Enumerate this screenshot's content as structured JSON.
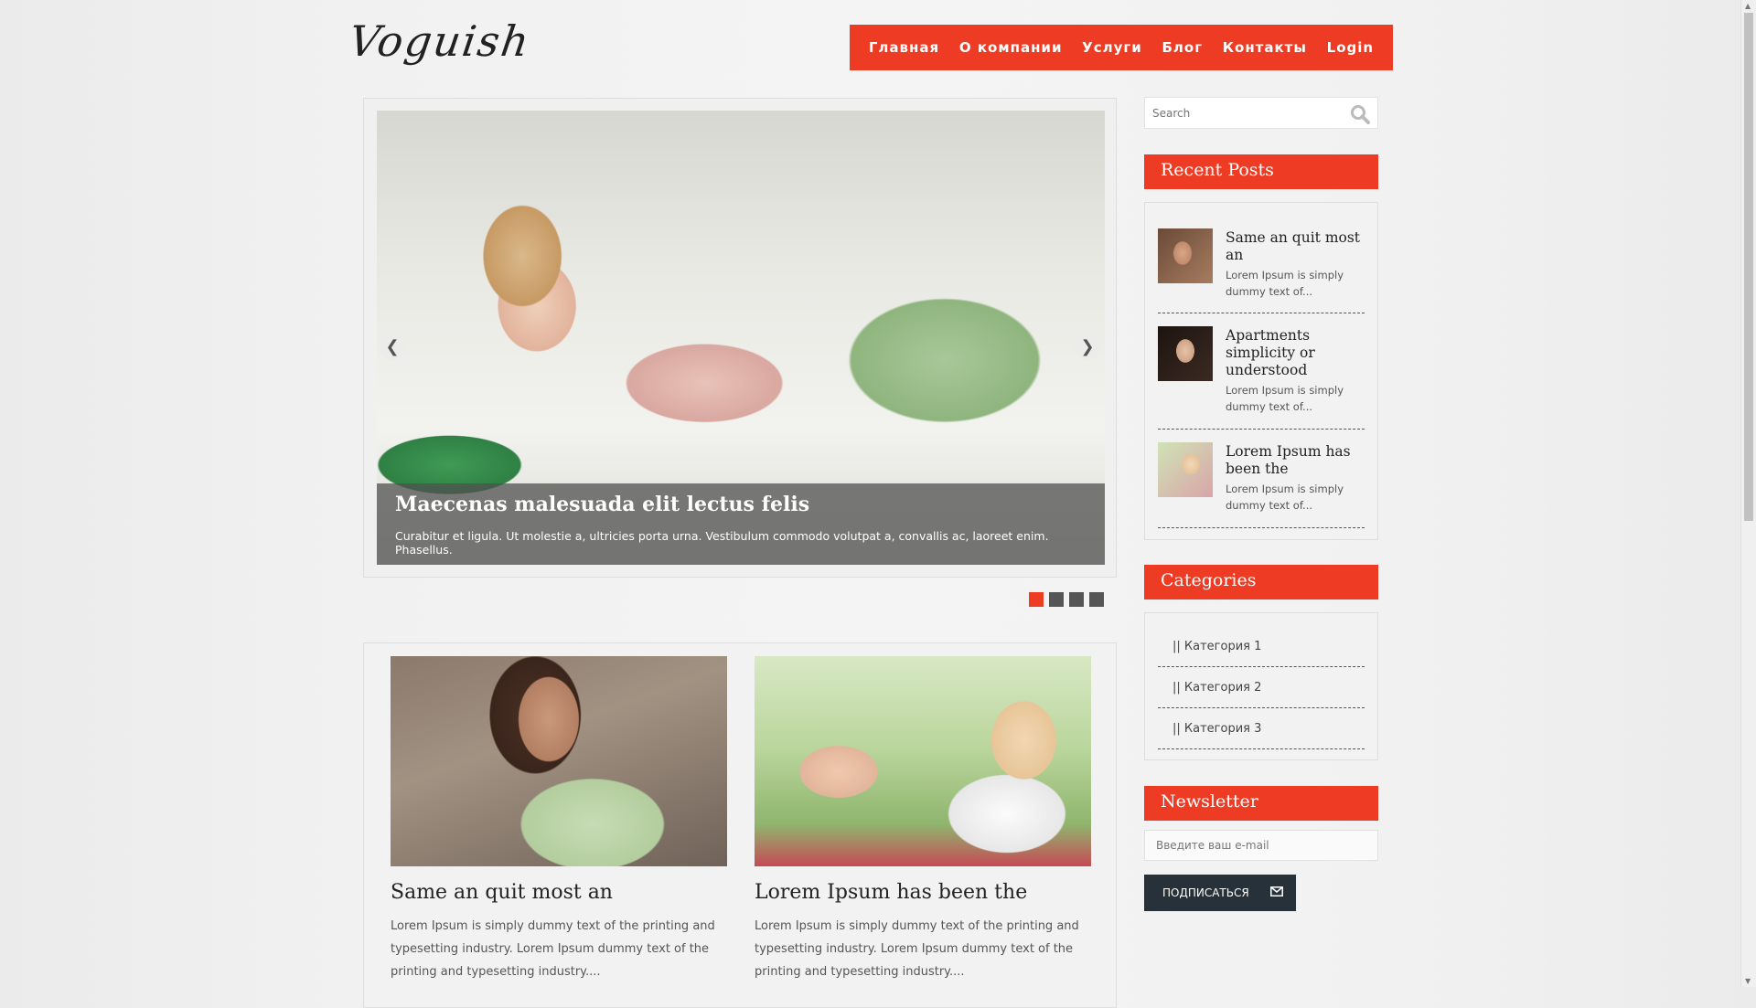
{
  "header": {
    "logo": "Voguish",
    "nav": [
      "Главная",
      "О компании",
      "Услуги",
      "Блог",
      "Контакты",
      "Login"
    ]
  },
  "slider": {
    "title": "Maecenas malesuada elit lectus felis",
    "text": "Curabitur et ligula. Ut molestie a, ultricies porta urna. Vestibulum commodo volutpat a, convallis ac, laoreet enim. Phasellus.",
    "active_dot": 1,
    "dot_count": 4
  },
  "posts": [
    {
      "title": "Same an quit most an",
      "text": "Lorem Ipsum is simply dummy text of the printing and typesetting industry. Lorem Ipsum dummy text of the printing and typesetting industry...."
    },
    {
      "title": "Lorem Ipsum has been the",
      "text": "Lorem Ipsum is simply dummy text of the printing and typesetting industry. Lorem Ipsum dummy text of the printing and typesetting industry...."
    }
  ],
  "sidebar": {
    "search_placeholder": "Search",
    "recent_title": "Recent Posts",
    "recent": [
      {
        "title": "Same an quit most an",
        "text": "Lorem Ipsum is simply dummy text of..."
      },
      {
        "title": "Apartments simplicity or understood",
        "text": "Lorem Ipsum is simply dummy text of..."
      },
      {
        "title": "Lorem Ipsum has been the",
        "text": "Lorem Ipsum is simply dummy text of..."
      }
    ],
    "categories_title": "Categories",
    "categories": [
      "|| Категория 1",
      "|| Категория 2",
      "|| Категория 3"
    ],
    "newsletter_title": "Newsletter",
    "email_placeholder": "Введите ваш e-mail",
    "subscribe_label": "ПОДПИСАТЬСЯ"
  },
  "colors": {
    "accent": "#ee3b24",
    "button_dark": "#263139"
  }
}
